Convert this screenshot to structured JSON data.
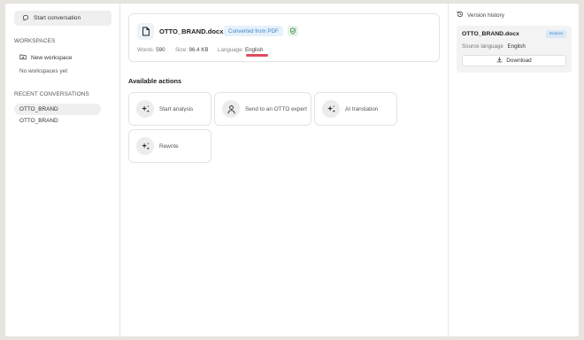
{
  "sidebar": {
    "start_conversation": "Start conversation",
    "workspaces_label": "WORKSPACES",
    "new_workspace": "New workspace",
    "no_workspaces": "No workspaces yet",
    "recent_label": "RECENT CONVERSATIONS",
    "conversations": [
      "OTTO_BRAND",
      "OTTO_BRAND"
    ]
  },
  "document": {
    "title": "OTTO_BRAND.docx",
    "converted_badge": "Converted from PDF",
    "words_label": "Words:",
    "words_value": "590",
    "size_label": "Size:",
    "size_value": "96.4 KB",
    "language_label": "Language:",
    "language_value": "English"
  },
  "actions": {
    "title": "Available actions",
    "items": [
      "Start analysis",
      "Send to an OTTO expert",
      "AI translation",
      "Rewrite"
    ]
  },
  "version_history": {
    "title": "Version history",
    "file_name": "OTTO_BRAND.docx",
    "badge": "Source",
    "source_language_label": "Source language",
    "source_language_value": "English",
    "download_label": "Download"
  },
  "colors": {
    "converted_badge_text": "#3d85c6",
    "language_underline": "#e04a5f",
    "shield": "#3a8a4c"
  }
}
